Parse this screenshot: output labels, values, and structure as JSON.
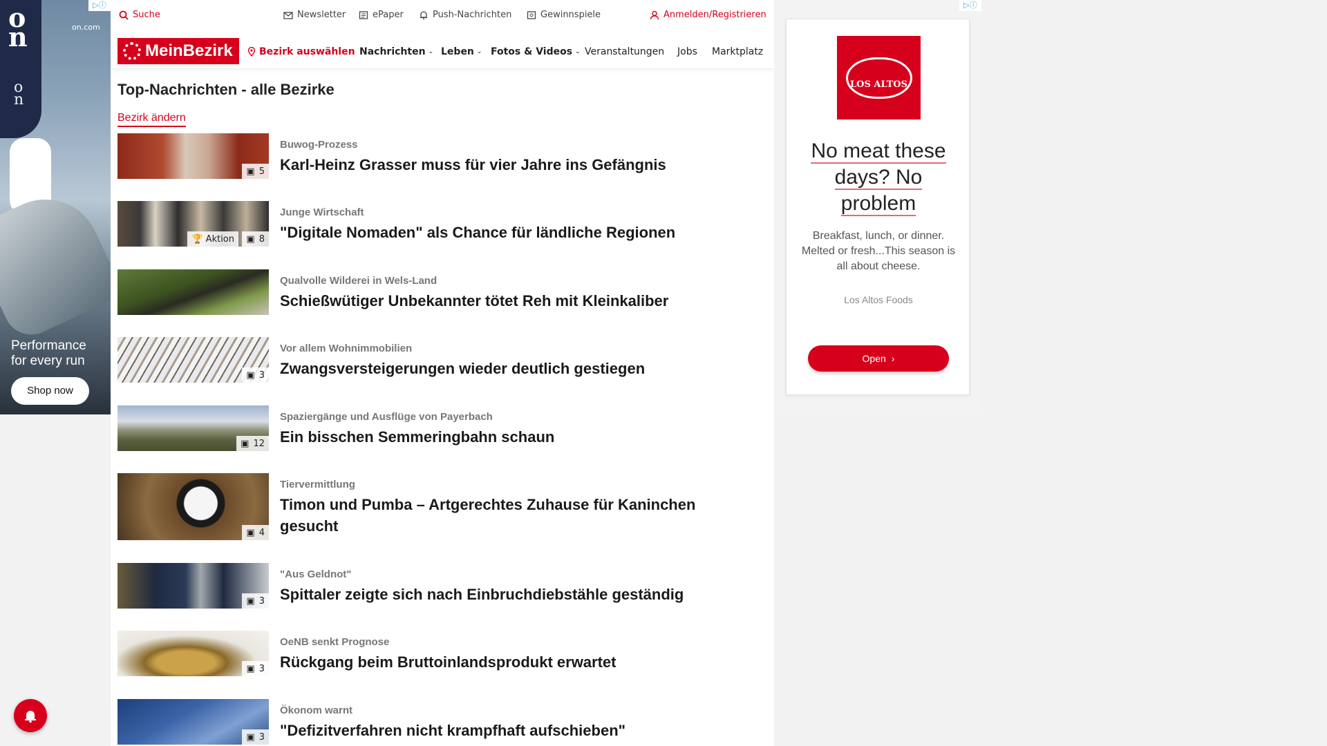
{
  "left_ad": {
    "domain": "on.com",
    "adchoice": "▷ⓘ",
    "tagline_1": "Performance",
    "tagline_2": "for every run",
    "cta": "Shop now"
  },
  "topbar": {
    "search": "Suche",
    "newsletter": "Newsletter",
    "epaper": "ePaper",
    "push": "Push-Nachrichten",
    "gewinnspiele": "Gewinnspiele",
    "login": "Anmelden/Registrieren"
  },
  "nav": {
    "logo": "MeinBezirk",
    "bezirk": "Bezirk auswählen",
    "items": [
      "Nachrichten",
      "Leben",
      "Fotos & Videos",
      "Veranstaltungen",
      "Jobs",
      "Marktplatz"
    ]
  },
  "page": {
    "title": "Top-Nachrichten - alle Bezirke",
    "change_link": "Bezirk ändern"
  },
  "articles": [
    {
      "kicker": "Buwog-Prozess",
      "headline": "Karl-Heinz Grasser muss für vier Jahre ins Gefängnis",
      "count": "5"
    },
    {
      "kicker": "Junge Wirtschaft",
      "headline": "\"Digitale Nomaden\" als Chance für ländliche Regionen",
      "count": "8",
      "tag": "Aktion"
    },
    {
      "kicker": "Qualvolle Wilderei in Wels-Land",
      "headline": "Schießwütiger Unbekannter tötet Reh mit Kleinkaliber"
    },
    {
      "kicker": "Vor allem Wohnimmobilien",
      "headline": "Zwangsversteigerungen wieder deutlich gestiegen",
      "count": "3"
    },
    {
      "kicker": "Spaziergänge und Ausflüge von Payerbach",
      "headline": "Ein bisschen Semmeringbahn schaun",
      "count": "12"
    },
    {
      "kicker": "Tiervermittlung",
      "headline": "Timon und Pumba – Artgerechtes Zuhause für Kaninchen gesucht",
      "count": "4"
    },
    {
      "kicker": "\"Aus Geldnot\"",
      "headline": "Spittaler zeigte sich nach Einbruchdiebstähle geständig",
      "count": "3"
    },
    {
      "kicker": "OeNB senkt Prognose",
      "headline": "Rückgang beim Bruttoinlandsprodukt erwartet",
      "count": "3"
    },
    {
      "kicker": "Ökonom warnt",
      "headline": "\"Defizitverfahren nicht krampfhaft aufschieben\"",
      "count": "3"
    }
  ],
  "right_ad": {
    "adchoice": "▷ⓘ",
    "brand_badge": "LOS ALTOS",
    "headline": "No meat these days? No problem",
    "body": "Breakfast, lunch, or dinner. Melted or fresh...This season is all about cheese.",
    "advertiser": "Los Altos Foods",
    "cta": "Open"
  },
  "colors": {
    "brand_red": "#d6001c"
  }
}
